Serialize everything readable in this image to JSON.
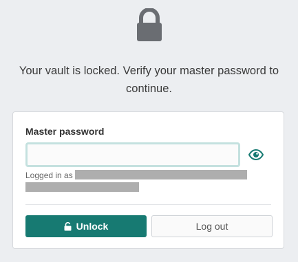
{
  "lock_icon": "lock-icon",
  "message": "Your vault is locked. Verify your master password to continue.",
  "form": {
    "label": "Master password",
    "password_value": "",
    "toggle_icon": "eye-icon",
    "logged_in_prefix": "Logged in as"
  },
  "actions": {
    "unlock_icon": "unlock-icon",
    "unlock_label": "Unlock",
    "logout_label": "Log out"
  },
  "colors": {
    "primary": "#177a72",
    "background": "#eceef1",
    "lock_icon": "#6a6d72"
  }
}
